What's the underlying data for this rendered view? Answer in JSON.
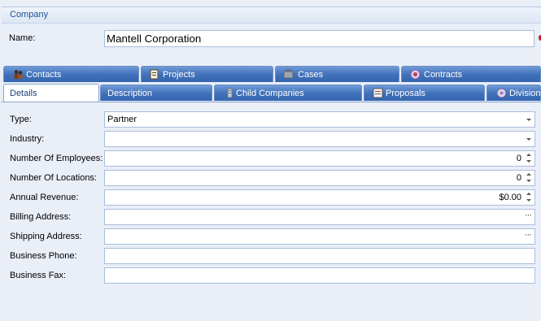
{
  "group": {
    "title": "Company"
  },
  "name": {
    "label": "Name:",
    "value": "Mantell Corporation"
  },
  "tabs_row1": [
    {
      "label": "Contacts",
      "icon": "contacts-icon"
    },
    {
      "label": "Projects",
      "icon": "projects-icon"
    },
    {
      "label": "Cases",
      "icon": "cases-icon"
    },
    {
      "label": "Contracts",
      "icon": "contracts-icon"
    }
  ],
  "tabs_row2": [
    {
      "label": "Details",
      "active": true
    },
    {
      "label": "Description"
    },
    {
      "label": "Child Companies",
      "icon": "child-companies-icon"
    },
    {
      "label": "Proposals",
      "icon": "proposals-icon"
    },
    {
      "label": "Divisions",
      "icon": "divisions-icon"
    }
  ],
  "fields": {
    "type": {
      "label": "Type:",
      "value": "Partner"
    },
    "industry": {
      "label": "Industry:",
      "value": ""
    },
    "employees": {
      "label": "Number Of Employees:",
      "value": "0"
    },
    "locations": {
      "label": "Number Of Locations:",
      "value": "0"
    },
    "revenue": {
      "label": "Annual Revenue:",
      "value": "$0.00"
    },
    "billing": {
      "label": "Billing Address:",
      "value": ""
    },
    "shipping": {
      "label": "Shipping Address:",
      "value": ""
    },
    "phone": {
      "label": "Business Phone:",
      "value": ""
    },
    "fax": {
      "label": "Business Fax:",
      "value": ""
    }
  },
  "colors": {
    "tab_blue": "#3f6fb8",
    "header_text": "#1f4e96",
    "border": "#a9bedb"
  }
}
